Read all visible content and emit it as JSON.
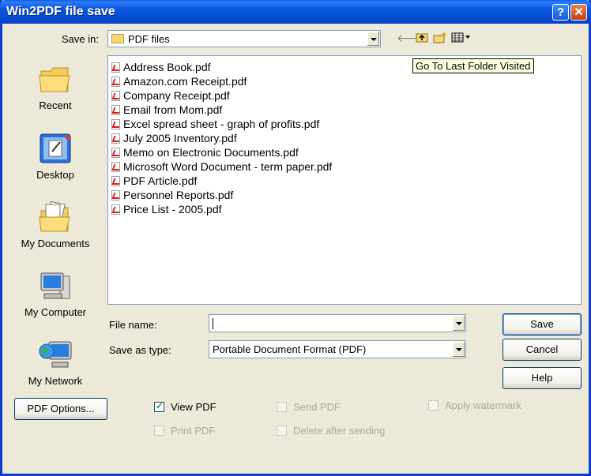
{
  "window": {
    "title": "Win2PDF file save",
    "help_glyph": "?",
    "close_glyph": "✕"
  },
  "save_in": {
    "label": "Save in:",
    "value": "PDF files"
  },
  "toolbar": {
    "back_glyph": "🡐",
    "up_glyph": "⮤",
    "newfolder_glyph": "✱",
    "view_glyph": "▦▾",
    "tooltip": "Go To Last Folder Visited"
  },
  "places": [
    {
      "label": "Recent",
      "icon": "recent-folder-icon"
    },
    {
      "label": "Desktop",
      "icon": "desktop-icon"
    },
    {
      "label": "My Documents",
      "icon": "my-documents-icon"
    },
    {
      "label": "My Computer",
      "icon": "my-computer-icon"
    },
    {
      "label": "My Network",
      "icon": "my-network-icon"
    }
  ],
  "files": [
    "Address Book.pdf",
    "Amazon.com Receipt.pdf",
    "Company Receipt.pdf",
    "Email from Mom.pdf",
    "Excel spread sheet - graph of profits.pdf",
    "July 2005 Inventory.pdf",
    "Memo on Electronic Documents.pdf",
    "Microsoft Word Document - term paper.pdf",
    "PDF Article.pdf",
    "Personnel Reports.pdf",
    "Price List - 2005.pdf"
  ],
  "form": {
    "file_name_label": "File name:",
    "file_name_value": "",
    "save_type_label": "Save as type:",
    "save_type_value": "Portable Document Format (PDF)"
  },
  "buttons": {
    "save": "Save",
    "cancel": "Cancel",
    "help": "Help",
    "pdf_options": "PDF Options..."
  },
  "options": {
    "view_pdf": {
      "label": "View PDF",
      "checked": true,
      "enabled": true
    },
    "send_pdf": {
      "label": "Send PDF",
      "checked": false,
      "enabled": false
    },
    "apply_watermark": {
      "label": "Apply watermark",
      "checked": false,
      "enabled": false
    },
    "print_pdf": {
      "label": "Print PDF",
      "checked": false,
      "enabled": false
    },
    "delete_after_sending": {
      "label": "Delete after sending",
      "checked": false,
      "enabled": false
    }
  },
  "colors": {
    "titlebar": "#0A3FCE",
    "dialog_bg": "#ECE9D8",
    "tooltip_bg": "#FFFFE1"
  }
}
